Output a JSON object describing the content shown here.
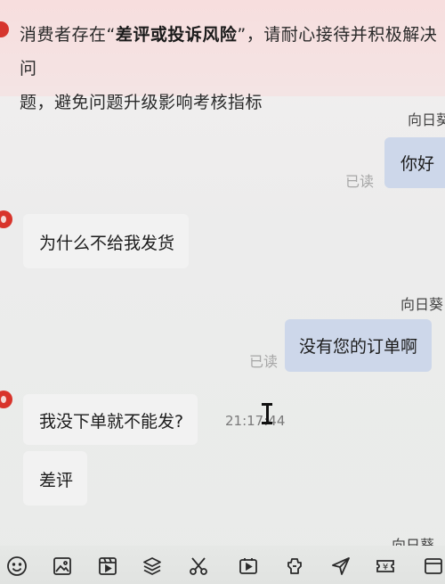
{
  "warning": {
    "line1_pre": "消费者存在“",
    "line1_hl": "差评或投诉风险",
    "line1_post": "”，请耐心接待并积极解决问",
    "line2": "题，避免问题升级影响考核指标"
  },
  "messages": [
    {
      "sender": "向日葵",
      "text": "你好",
      "read": "已读",
      "direction": "out"
    },
    {
      "text": "为什么不给我发货",
      "direction": "in"
    },
    {
      "sender": "向日葵",
      "text": "没有您的订单啊",
      "read": "已读",
      "direction": "out"
    },
    {
      "text": "我没下单就不能发?",
      "time": "21:17:44",
      "direction": "in"
    },
    {
      "text": "差评",
      "direction": "in"
    },
    {
      "sender": "向日葵",
      "direction": "out"
    }
  ],
  "toolbar": {
    "icons": [
      "emoji-icon",
      "image-icon",
      "video-icon",
      "layers-icon",
      "scissors-icon",
      "video-play-icon",
      "handshake-icon",
      "send-icon",
      "coupon-icon",
      "more-icon"
    ],
    "coupon_symbol": "¥"
  },
  "colors": {
    "warning_bg": "#f7dede",
    "outgoing_bubble": "#cdd7ea",
    "incoming_bubble": "#f2f2f2",
    "avatar_red": "#d8342b",
    "read_gray": "#a6a6a6"
  }
}
